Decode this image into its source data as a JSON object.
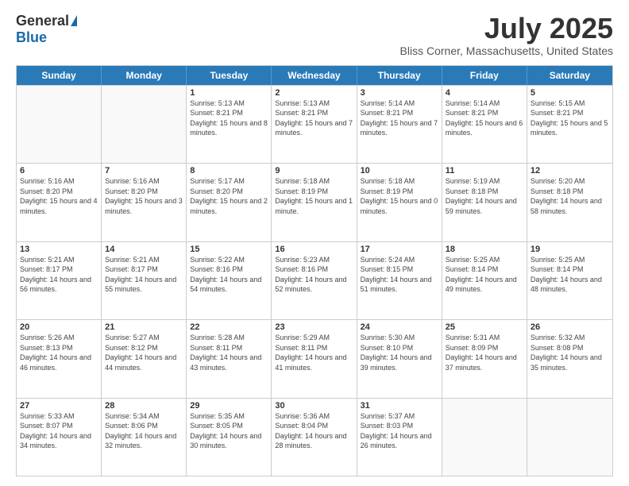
{
  "logo": {
    "general": "General",
    "blue": "Blue"
  },
  "header": {
    "month": "July 2025",
    "location": "Bliss Corner, Massachusetts, United States"
  },
  "weekdays": [
    "Sunday",
    "Monday",
    "Tuesday",
    "Wednesday",
    "Thursday",
    "Friday",
    "Saturday"
  ],
  "weeks": [
    [
      {
        "day": "",
        "sunrise": "",
        "sunset": "",
        "daylight": ""
      },
      {
        "day": "",
        "sunrise": "",
        "sunset": "",
        "daylight": ""
      },
      {
        "day": "1",
        "sunrise": "Sunrise: 5:13 AM",
        "sunset": "Sunset: 8:21 PM",
        "daylight": "Daylight: 15 hours and 8 minutes."
      },
      {
        "day": "2",
        "sunrise": "Sunrise: 5:13 AM",
        "sunset": "Sunset: 8:21 PM",
        "daylight": "Daylight: 15 hours and 7 minutes."
      },
      {
        "day": "3",
        "sunrise": "Sunrise: 5:14 AM",
        "sunset": "Sunset: 8:21 PM",
        "daylight": "Daylight: 15 hours and 7 minutes."
      },
      {
        "day": "4",
        "sunrise": "Sunrise: 5:14 AM",
        "sunset": "Sunset: 8:21 PM",
        "daylight": "Daylight: 15 hours and 6 minutes."
      },
      {
        "day": "5",
        "sunrise": "Sunrise: 5:15 AM",
        "sunset": "Sunset: 8:21 PM",
        "daylight": "Daylight: 15 hours and 5 minutes."
      }
    ],
    [
      {
        "day": "6",
        "sunrise": "Sunrise: 5:16 AM",
        "sunset": "Sunset: 8:20 PM",
        "daylight": "Daylight: 15 hours and 4 minutes."
      },
      {
        "day": "7",
        "sunrise": "Sunrise: 5:16 AM",
        "sunset": "Sunset: 8:20 PM",
        "daylight": "Daylight: 15 hours and 3 minutes."
      },
      {
        "day": "8",
        "sunrise": "Sunrise: 5:17 AM",
        "sunset": "Sunset: 8:20 PM",
        "daylight": "Daylight: 15 hours and 2 minutes."
      },
      {
        "day": "9",
        "sunrise": "Sunrise: 5:18 AM",
        "sunset": "Sunset: 8:19 PM",
        "daylight": "Daylight: 15 hours and 1 minute."
      },
      {
        "day": "10",
        "sunrise": "Sunrise: 5:18 AM",
        "sunset": "Sunset: 8:19 PM",
        "daylight": "Daylight: 15 hours and 0 minutes."
      },
      {
        "day": "11",
        "sunrise": "Sunrise: 5:19 AM",
        "sunset": "Sunset: 8:18 PM",
        "daylight": "Daylight: 14 hours and 59 minutes."
      },
      {
        "day": "12",
        "sunrise": "Sunrise: 5:20 AM",
        "sunset": "Sunset: 8:18 PM",
        "daylight": "Daylight: 14 hours and 58 minutes."
      }
    ],
    [
      {
        "day": "13",
        "sunrise": "Sunrise: 5:21 AM",
        "sunset": "Sunset: 8:17 PM",
        "daylight": "Daylight: 14 hours and 56 minutes."
      },
      {
        "day": "14",
        "sunrise": "Sunrise: 5:21 AM",
        "sunset": "Sunset: 8:17 PM",
        "daylight": "Daylight: 14 hours and 55 minutes."
      },
      {
        "day": "15",
        "sunrise": "Sunrise: 5:22 AM",
        "sunset": "Sunset: 8:16 PM",
        "daylight": "Daylight: 14 hours and 54 minutes."
      },
      {
        "day": "16",
        "sunrise": "Sunrise: 5:23 AM",
        "sunset": "Sunset: 8:16 PM",
        "daylight": "Daylight: 14 hours and 52 minutes."
      },
      {
        "day": "17",
        "sunrise": "Sunrise: 5:24 AM",
        "sunset": "Sunset: 8:15 PM",
        "daylight": "Daylight: 14 hours and 51 minutes."
      },
      {
        "day": "18",
        "sunrise": "Sunrise: 5:25 AM",
        "sunset": "Sunset: 8:14 PM",
        "daylight": "Daylight: 14 hours and 49 minutes."
      },
      {
        "day": "19",
        "sunrise": "Sunrise: 5:25 AM",
        "sunset": "Sunset: 8:14 PM",
        "daylight": "Daylight: 14 hours and 48 minutes."
      }
    ],
    [
      {
        "day": "20",
        "sunrise": "Sunrise: 5:26 AM",
        "sunset": "Sunset: 8:13 PM",
        "daylight": "Daylight: 14 hours and 46 minutes."
      },
      {
        "day": "21",
        "sunrise": "Sunrise: 5:27 AM",
        "sunset": "Sunset: 8:12 PM",
        "daylight": "Daylight: 14 hours and 44 minutes."
      },
      {
        "day": "22",
        "sunrise": "Sunrise: 5:28 AM",
        "sunset": "Sunset: 8:11 PM",
        "daylight": "Daylight: 14 hours and 43 minutes."
      },
      {
        "day": "23",
        "sunrise": "Sunrise: 5:29 AM",
        "sunset": "Sunset: 8:11 PM",
        "daylight": "Daylight: 14 hours and 41 minutes."
      },
      {
        "day": "24",
        "sunrise": "Sunrise: 5:30 AM",
        "sunset": "Sunset: 8:10 PM",
        "daylight": "Daylight: 14 hours and 39 minutes."
      },
      {
        "day": "25",
        "sunrise": "Sunrise: 5:31 AM",
        "sunset": "Sunset: 8:09 PM",
        "daylight": "Daylight: 14 hours and 37 minutes."
      },
      {
        "day": "26",
        "sunrise": "Sunrise: 5:32 AM",
        "sunset": "Sunset: 8:08 PM",
        "daylight": "Daylight: 14 hours and 35 minutes."
      }
    ],
    [
      {
        "day": "27",
        "sunrise": "Sunrise: 5:33 AM",
        "sunset": "Sunset: 8:07 PM",
        "daylight": "Daylight: 14 hours and 34 minutes."
      },
      {
        "day": "28",
        "sunrise": "Sunrise: 5:34 AM",
        "sunset": "Sunset: 8:06 PM",
        "daylight": "Daylight: 14 hours and 32 minutes."
      },
      {
        "day": "29",
        "sunrise": "Sunrise: 5:35 AM",
        "sunset": "Sunset: 8:05 PM",
        "daylight": "Daylight: 14 hours and 30 minutes."
      },
      {
        "day": "30",
        "sunrise": "Sunrise: 5:36 AM",
        "sunset": "Sunset: 8:04 PM",
        "daylight": "Daylight: 14 hours and 28 minutes."
      },
      {
        "day": "31",
        "sunrise": "Sunrise: 5:37 AM",
        "sunset": "Sunset: 8:03 PM",
        "daylight": "Daylight: 14 hours and 26 minutes."
      },
      {
        "day": "",
        "sunrise": "",
        "sunset": "",
        "daylight": ""
      },
      {
        "day": "",
        "sunrise": "",
        "sunset": "",
        "daylight": ""
      }
    ]
  ]
}
